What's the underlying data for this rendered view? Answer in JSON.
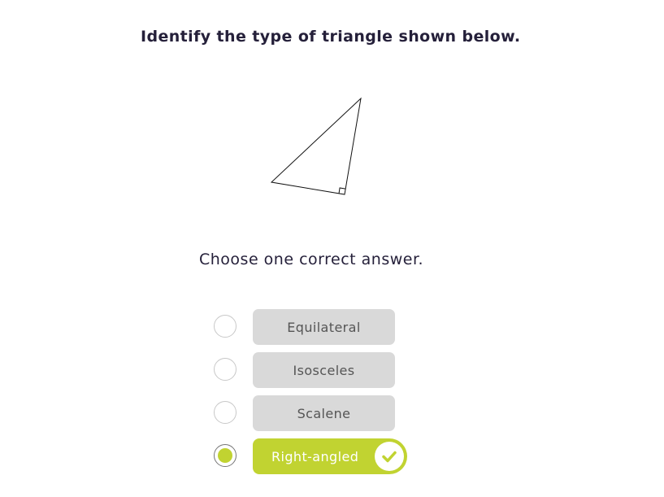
{
  "question": {
    "title": "Identify the type of triangle shown below."
  },
  "instruction": "Choose one correct answer.",
  "options": [
    {
      "label": "Equilateral",
      "selected": false,
      "correct": false
    },
    {
      "label": "Isosceles",
      "selected": false,
      "correct": false
    },
    {
      "label": "Scalene",
      "selected": false,
      "correct": false
    },
    {
      "label": "Right-angled",
      "selected": true,
      "correct": true
    }
  ],
  "colors": {
    "accent": "#c1d331",
    "option_bg": "#d9d9d9",
    "option_text": "#555555",
    "heading_text": "#25203a"
  },
  "icons": {
    "correct_marker": "checkmark-icon",
    "figure": "right-triangle-figure"
  }
}
